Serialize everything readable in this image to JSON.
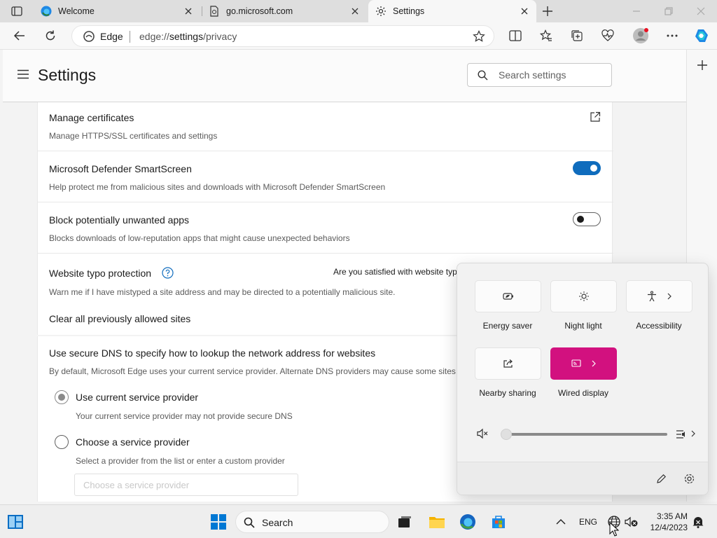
{
  "browser": {
    "tabs": [
      {
        "title": "Welcome",
        "active": false
      },
      {
        "title": "go.microsoft.com",
        "active": false
      },
      {
        "title": "Settings",
        "active": true
      }
    ],
    "address": {
      "site_label": "Edge",
      "url_prefix": "edge://",
      "url_strong": "settings",
      "url_suffix": "/privacy"
    }
  },
  "settings": {
    "title": "Settings",
    "search_placeholder": "Search settings",
    "rows": [
      {
        "title": "Manage certificates",
        "desc": "Manage HTTPS/SSL certificates and settings"
      },
      {
        "title": "Microsoft Defender SmartScreen",
        "desc": "Help protect me from malicious sites and downloads with Microsoft Defender SmartScreen",
        "toggle": true
      },
      {
        "title": "Block potentially unwanted apps",
        "desc": "Blocks downloads of low-reputation apps that might cause unexpected behaviors",
        "toggle": false
      },
      {
        "title": "Website typo protection",
        "desc": "Warn me if I have mistyped a site address and may be directed to a potentially malicious site.",
        "feedback": "Are you satisfied with website typ"
      },
      {
        "title": "Clear all previously allowed sites"
      }
    ],
    "dns": {
      "title": "Use secure DNS to specify how to lookup the network address for websites",
      "desc": "By default, Microsoft Edge uses your current service provider. Alternate DNS providers may cause some sites to",
      "options": [
        {
          "label": "Use current service provider",
          "desc": "Your current service provider may not provide secure DNS",
          "checked": true
        },
        {
          "label": "Choose a service provider",
          "desc": "Select a provider from the list or enter a custom provider",
          "checked": false
        }
      ],
      "provider_placeholder": "Choose a service provider"
    }
  },
  "quick_settings": {
    "tiles": [
      {
        "label": "Energy saver",
        "icon": "energy-saver-icon"
      },
      {
        "label": "Night light",
        "icon": "night-light-icon"
      },
      {
        "label": "Accessibility",
        "icon": "accessibility-icon"
      },
      {
        "label": "Nearby sharing",
        "icon": "nearby-sharing-icon"
      },
      {
        "label": "Wired display",
        "icon": "cast-icon",
        "active": true
      }
    ],
    "volume_level": 0,
    "accent_color": "#d2117f"
  },
  "taskbar": {
    "search_label": "Search",
    "language": "ENG",
    "time": "3:35 AM",
    "date": "12/4/2023"
  }
}
